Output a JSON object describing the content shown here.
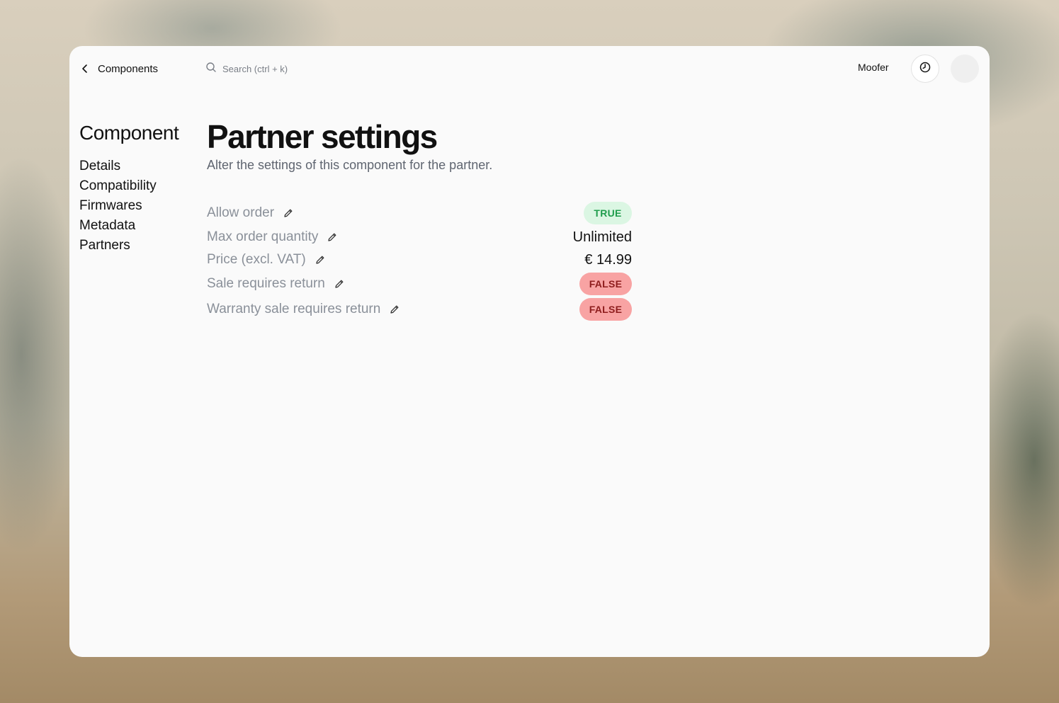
{
  "topbar": {
    "back_label": "Components",
    "search_placeholder": "Search (ctrl + k)",
    "organization": "Moofer"
  },
  "sidebar": {
    "heading": "Component",
    "items": [
      {
        "label": "Details"
      },
      {
        "label": "Compatibility"
      },
      {
        "label": "Firmwares"
      },
      {
        "label": "Metadata"
      },
      {
        "label": "Partners"
      }
    ]
  },
  "main": {
    "title": "Partner settings",
    "subtitle": "Alter the settings of this component for the partner."
  },
  "settings": [
    {
      "label": "Allow order",
      "value": "TRUE",
      "kind": "badge-true"
    },
    {
      "label": "Max order quantity",
      "value": "Unlimited",
      "kind": "text"
    },
    {
      "label": "Price (excl. VAT)",
      "value": "€ 14.99",
      "kind": "text"
    },
    {
      "label": "Sale requires return",
      "value": "FALSE",
      "kind": "badge-false"
    },
    {
      "label": "Warranty sale requires return",
      "value": "FALSE",
      "kind": "badge-false"
    }
  ],
  "icons": {
    "back": "chevron-left-icon",
    "search": "search-icon",
    "history": "clock-icon",
    "edit": "pencil-icon"
  },
  "colors": {
    "true_badge_bg": "#dbf6e3",
    "true_badge_text": "#1f9d4c",
    "false_badge_bg": "#f8a3a3",
    "false_badge_text": "#8e1d1d"
  }
}
